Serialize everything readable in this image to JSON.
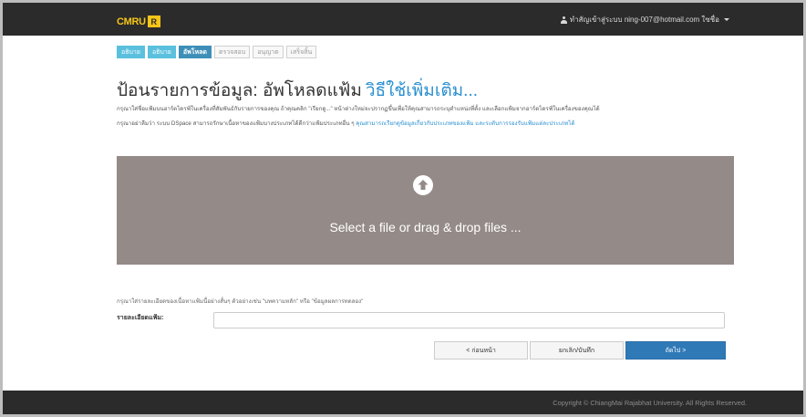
{
  "header": {
    "logo_text": "CMRU",
    "logo_mark": "R",
    "user_label": "ทำสัญเข้าสู่ระบบ ning-007@hotmail.com ใซชื่อ"
  },
  "steps": [
    {
      "label": "อธิบาย",
      "state": "done"
    },
    {
      "label": "อธิบาย",
      "state": "done"
    },
    {
      "label": "อัพโหลด",
      "state": "current"
    },
    {
      "label": "ตรวจสอบ",
      "state": "pending"
    },
    {
      "label": "อนุญาต",
      "state": "pending"
    },
    {
      "label": "เสร็จสิ้น",
      "state": "pending"
    }
  ],
  "page": {
    "title": "ป้อนรายการข้อมูล: อัพโหลดแฟ้ม",
    "help_link": "วิธีใช้เพิ่มเติม...",
    "instructions_line1": "กรุณาใส่ชื่อแฟ้มบนฮาร์ดไดรฟ์ในเครื่องที่สัมพันธ์กับรายการของคุณ ถ้าคุณคลิก \"เรียกดู...\" หน้าต่างใหม่จะปรากฏขึ้นเพื่อให้คุณสามารถระบุตำแหน่งที่ตั้ง และเลือกแฟ้มจากฮาร์ดไดรฟ์ในเครื่องของคุณได้",
    "instructions_line2_text": "กรุณาอย่าลืมว่า ระบบ DSpace สามารถรักษาเนื้อหาของแฟ้มบางประเภทได้ดีกว่าแฟ้มประเภทอื่น ๆ",
    "instructions_line2_link": "คุณสามารถเรียกดูข้อมูลเกี่ยวกับประเภทของแฟ้ม และระดับการรองรับแฟ้มแต่ละประเภทได้"
  },
  "dropzone": {
    "icon": "upload-arrow-icon",
    "text": "Select a file or drag & drop files ..."
  },
  "description": {
    "hint": "กรุณาใส่รายละเอียดของเนื้อหาแฟ้มนี้อย่างสั้นๆ ตัวอย่างเช่น \"บทความหลัก\" หรือ \"ข้อมูลผลการทดลอง\"",
    "label": "รายละเอียดแฟ้ม:",
    "value": ""
  },
  "buttons": {
    "previous": "< ก่อนหน้า",
    "save": "ยกเลิก/บันทึก",
    "next": "ถัดไป >"
  },
  "footer": {
    "copyright": "Copyright © ChiangMai Rajabhat University. All Rights Reserved."
  },
  "colors": {
    "topbar": "#2b2b2b",
    "logo": "#f5c518",
    "step_done": "#5bc0de",
    "step_current": "#3d8fb8",
    "dropzone": "#948a87",
    "primary_button": "#2f79b7",
    "link": "#2a8fd0"
  }
}
